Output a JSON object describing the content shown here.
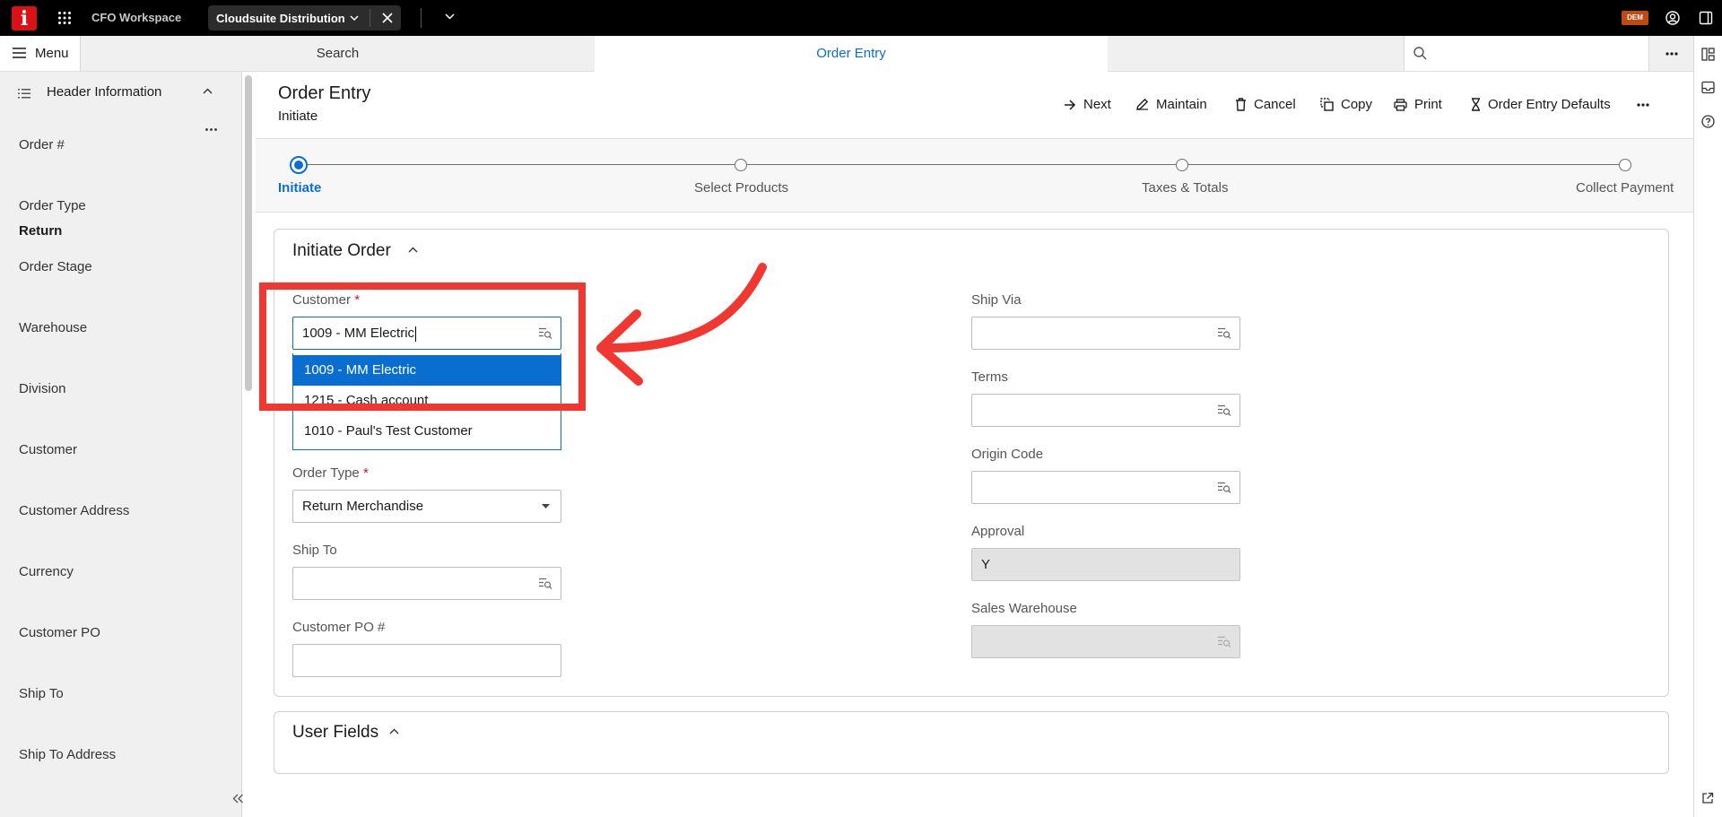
{
  "topbar": {
    "logo_letter": "i",
    "workspace": "CFO Workspace",
    "active_tab": "Cloudsuite Distribution",
    "user_badge": "DEM"
  },
  "navbar": {
    "menu_label": "Menu",
    "search_tab": "Search",
    "order_tab": "Order Entry"
  },
  "left_panel": {
    "title": "Header Information",
    "items": [
      {
        "label": "Order #",
        "value": ""
      },
      {
        "label": "Order Type",
        "value": "Return"
      },
      {
        "label": "Order Stage",
        "value": ""
      },
      {
        "label": "Warehouse",
        "value": ""
      },
      {
        "label": "Division",
        "value": ""
      },
      {
        "label": "Customer",
        "value": ""
      },
      {
        "label": "Customer Address",
        "value": ""
      },
      {
        "label": "Currency",
        "value": ""
      },
      {
        "label": "Customer PO",
        "value": ""
      },
      {
        "label": "Ship To",
        "value": ""
      },
      {
        "label": "Ship To Address",
        "value": ""
      }
    ]
  },
  "page": {
    "title": "Order Entry",
    "subtitle": "Initiate"
  },
  "toolbar": {
    "next": "Next",
    "maintain": "Maintain",
    "cancel": "Cancel",
    "copy": "Copy",
    "print": "Print",
    "defaults": "Order Entry Defaults"
  },
  "stepper": {
    "steps": [
      "Initiate",
      "Select Products",
      "Taxes & Totals",
      "Collect Payment"
    ],
    "active_index": 0
  },
  "initiate_order": {
    "title": "Initiate Order",
    "customer": {
      "label": "Customer",
      "required_mark": "*",
      "value": "1009 - MM Electric",
      "suggestions": [
        "1009 - MM Electric",
        "1215 - Cash account",
        "1010 - Paul's Test Customer"
      ],
      "selected_suggestion": 0
    },
    "order_type": {
      "label": "Order Type",
      "required_mark": "*",
      "value": "Return Merchandise"
    },
    "ship_to": {
      "label": "Ship To",
      "value": ""
    },
    "customer_po": {
      "label": "Customer PO #",
      "value": ""
    },
    "ship_via": {
      "label": "Ship Via",
      "value": ""
    },
    "terms": {
      "label": "Terms",
      "value": ""
    },
    "origin_code": {
      "label": "Origin Code",
      "value": ""
    },
    "approval": {
      "label": "Approval",
      "value": "Y"
    },
    "sales_warehouse": {
      "label": "Sales Warehouse",
      "value": ""
    }
  },
  "user_fields": {
    "title": "User Fields"
  },
  "colors": {
    "accent": "#0a6ed1",
    "annotation_red": "#f1372f",
    "logo_red": "#da1217",
    "badge_orange": "#c04a14"
  }
}
